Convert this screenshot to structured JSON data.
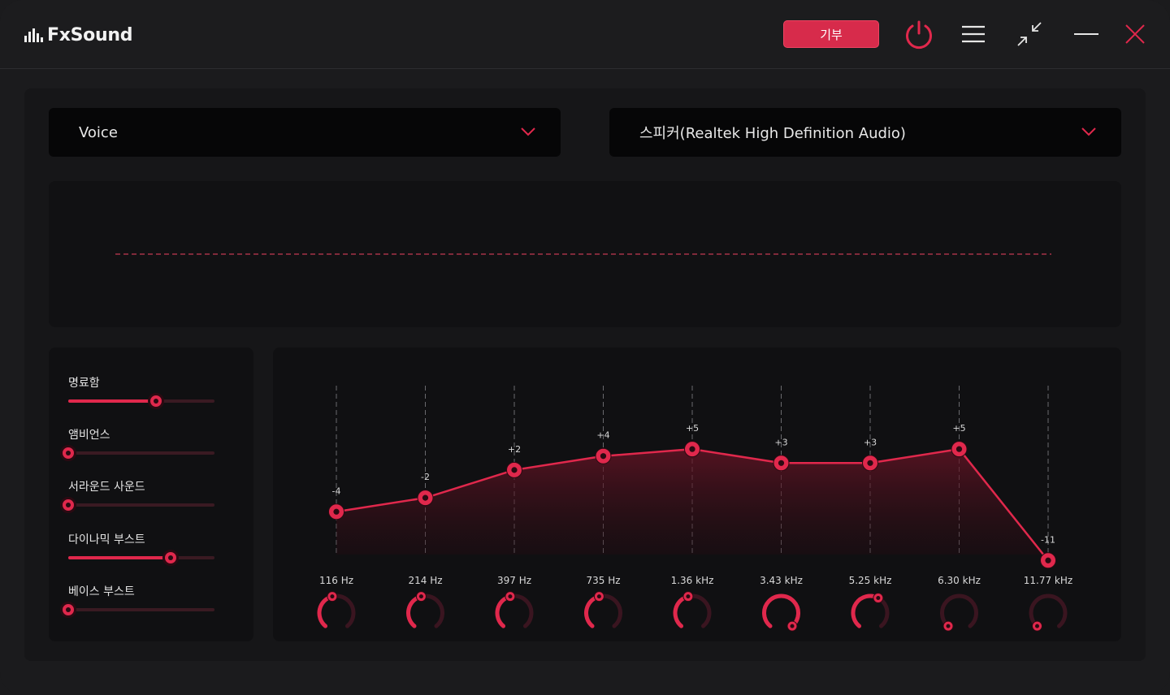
{
  "app": {
    "name": "FxSound",
    "donate_label": "기부"
  },
  "titlebar_icons": [
    "power-icon",
    "menu-icon",
    "collapse-icon",
    "minimize-icon",
    "close-icon"
  ],
  "preset": {
    "value": "Voice"
  },
  "output_device": {
    "value": "스피커(Realtek High Definition Audio)"
  },
  "effects": [
    {
      "label": "명료함",
      "level": 0.6
    },
    {
      "label": "앰비언스",
      "level": 0.0
    },
    {
      "label": "서라운드 사운드",
      "level": 0.0
    },
    {
      "label": "다이나믹 부스트",
      "level": 0.7
    },
    {
      "label": "베이스 부스트",
      "level": 0.0
    }
  ],
  "equalizer": {
    "bands": [
      {
        "freq": "116 Hz",
        "gain": -4,
        "gain_label": "-4",
        "knob": 0.45
      },
      {
        "freq": "214 Hz",
        "gain": -2,
        "gain_label": "-2",
        "knob": 0.45
      },
      {
        "freq": "397 Hz",
        "gain": 2,
        "gain_label": "+2",
        "knob": 0.45
      },
      {
        "freq": "735 Hz",
        "gain": 4,
        "gain_label": "+4",
        "knob": 0.45
      },
      {
        "freq": "1.36 kHz",
        "gain": 5,
        "gain_label": "+5",
        "knob": 0.45
      },
      {
        "freq": "3.43 kHz",
        "gain": 3,
        "gain_label": "+3",
        "knob": 1.0
      },
      {
        "freq": "5.25 kHz",
        "gain": 3,
        "gain_label": "+3",
        "knob": 0.6
      },
      {
        "freq": "6.30 kHz",
        "gain": 5,
        "gain_label": "+5",
        "knob": 0.0
      },
      {
        "freq": "11.77 kHz",
        "gain": -11,
        "gain_label": "-11",
        "knob": 0.0
      }
    ]
  },
  "colors": {
    "accent": "#e0284c",
    "background": "#1b1b1d",
    "panel": "#161618",
    "dropdown": "#060607"
  }
}
